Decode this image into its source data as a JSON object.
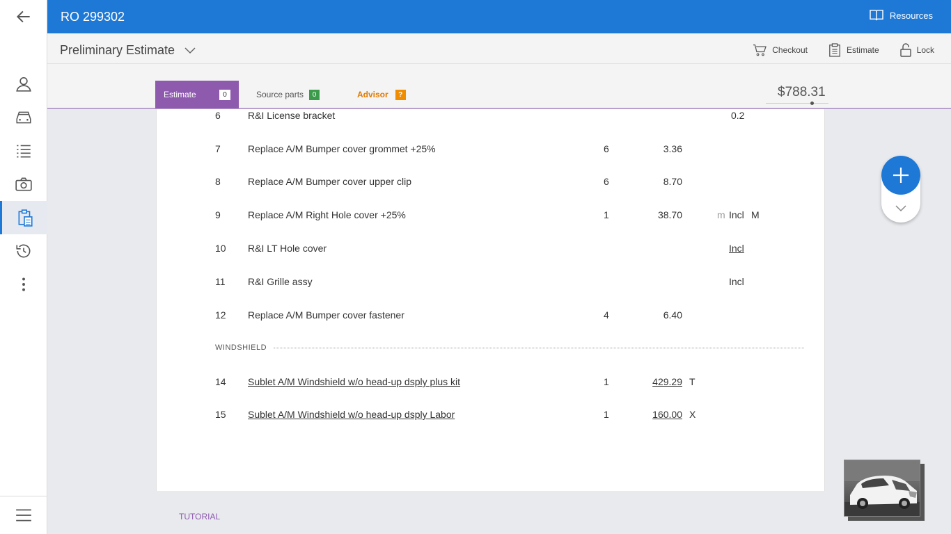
{
  "header": {
    "ro_title": "RO 299302",
    "resources_label": "Resources"
  },
  "subheader": {
    "title": "Preliminary Estimate",
    "actions": [
      {
        "label": "Checkout",
        "icon": "cart-icon"
      },
      {
        "label": "Estimate",
        "icon": "clipboard-calc-icon"
      },
      {
        "label": "Lock",
        "icon": "lock-icon"
      }
    ]
  },
  "tabs": {
    "estimate": {
      "label": "Estimate",
      "badge": "0"
    },
    "source_parts": {
      "label": "Source parts",
      "badge": "0"
    },
    "advisor": {
      "label": "Advisor",
      "badge": "?"
    }
  },
  "total": "$788.31",
  "rail": {
    "items": [
      "back-arrow-icon",
      "user-icon",
      "car-icon",
      "list-icon",
      "camera-icon",
      "estimate-icon",
      "history-icon",
      "more-vert-icon"
    ],
    "menu_icon": "hamburger-menu-icon"
  },
  "lines": [
    {
      "num": "6",
      "desc": "R&I License bracket",
      "qty": "",
      "price": "",
      "labor": "0.2"
    },
    {
      "num": "7",
      "desc": "Replace A/M Bumper cover grommet +25%",
      "qty": "6",
      "price": "3.36"
    },
    {
      "num": "8",
      "desc": "Replace A/M Bumper cover upper clip",
      "qty": "6",
      "price": "8.70"
    },
    {
      "num": "9",
      "desc": "Replace A/M Right Hole cover +25%",
      "qty": "1",
      "price": "38.70",
      "m": "m",
      "incl": "Incl",
      "mark": "M"
    },
    {
      "num": "10",
      "desc": "R&I LT Hole cover",
      "incl": "Incl"
    },
    {
      "num": "11",
      "desc": "R&I Grille assy",
      "incl": "Incl"
    },
    {
      "num": "12",
      "desc": "Replace A/M Bumper cover fastener",
      "qty": "4",
      "price": "6.40"
    }
  ],
  "section": {
    "label": "WINDSHIELD"
  },
  "windshield_lines": [
    {
      "num": "14",
      "desc": "Sublet A/M Windshield w/o head-up dsply plus kit",
      "qty": "1",
      "price": "429.29",
      "flag": "T"
    },
    {
      "num": "15",
      "desc": "Sublet A/M Windshield w/o head-up dsply Labor",
      "qty": "1",
      "price": "160.00",
      "flag": "X"
    }
  ],
  "tutorial_label": "TUTORIAL",
  "colors": {
    "primary": "#1e78d6",
    "tab_active": "#8e5aae",
    "advisor": "#e07a00",
    "source_badge": "#3a9b4a"
  }
}
